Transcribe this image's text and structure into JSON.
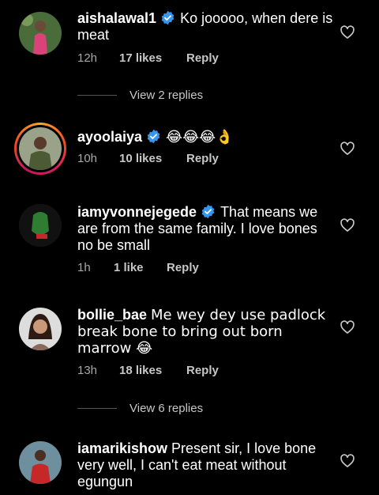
{
  "comments": [
    {
      "username": "aishalawal1",
      "verified": true,
      "text": "Ko jooooo, when dere is meat",
      "time": "12h",
      "likes": "17 likes",
      "reply": "Reply",
      "view_replies": "View 2 replies"
    },
    {
      "username": "ayoolaiya",
      "verified": true,
      "text": "😂😂😂👌",
      "time": "10h",
      "likes": "10 likes",
      "reply": "Reply"
    },
    {
      "username": "iamyvonnejegede",
      "verified": true,
      "text": "That means we are from the same family. I love bones no be small",
      "time": "1h",
      "likes": "1 like",
      "reply": "Reply"
    },
    {
      "username": "bollie_bae",
      "verified": false,
      "text": "Me wey dey use padlock break bone to bring out born marrow 😂",
      "time": "13h",
      "likes": "18 likes",
      "reply": "Reply",
      "view_replies": "View 6 replies"
    },
    {
      "username": "iamarikishow",
      "verified": false,
      "text": "Present sir, I love bone very well, I can't eat meat without egungun"
    }
  ],
  "colors": {
    "verified_badge": "#3797f0",
    "meta_text": "#a8a8a8",
    "story_ring": "#d81b60"
  },
  "icons": {
    "like": "heart-outline-icon",
    "verified": "verified-badge-icon"
  }
}
